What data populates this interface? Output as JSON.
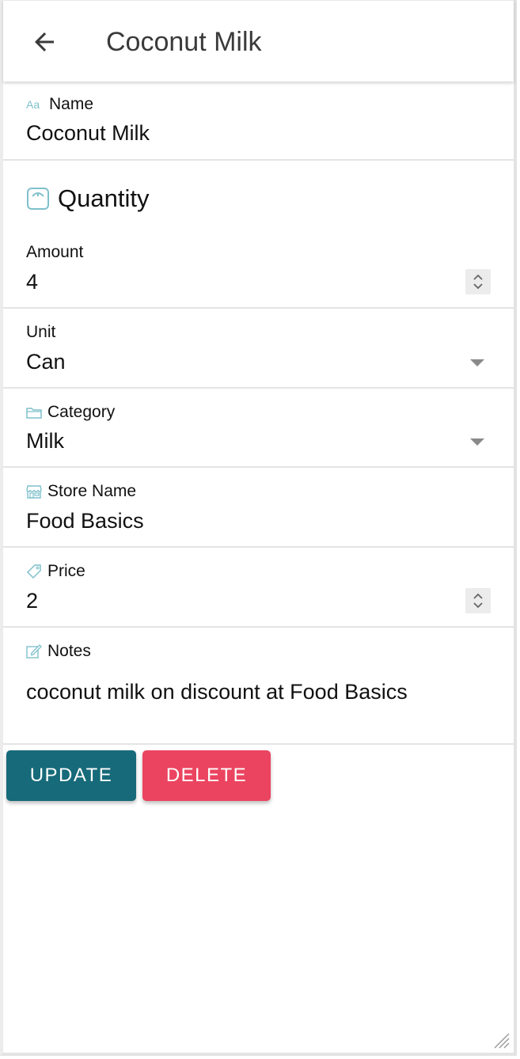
{
  "header": {
    "title": "Coconut Milk",
    "back_icon": "arrow-left-icon"
  },
  "fields": {
    "name": {
      "label": "Name",
      "value": "Coconut Milk",
      "icon": "text-format-icon"
    },
    "quantity": {
      "heading": "Quantity",
      "icon": "scale-icon"
    },
    "amount": {
      "label": "Amount",
      "value": "4"
    },
    "unit": {
      "label": "Unit",
      "value": "Can"
    },
    "category": {
      "label": "Category",
      "value": "Milk",
      "icon": "folder-icon"
    },
    "store": {
      "label": "Store Name",
      "value": "Food Basics",
      "icon": "store-icon"
    },
    "price": {
      "label": "Price",
      "value": "2",
      "icon": "tag-icon"
    },
    "notes": {
      "label": "Notes",
      "value": "coconut milk on discount at Food Basics",
      "icon": "edit-icon"
    }
  },
  "actions": {
    "update_label": "UPDATE",
    "delete_label": "DELETE"
  },
  "colors": {
    "update": "#176a79",
    "delete": "#eb4460",
    "icon_accent": "#7fc0cc"
  }
}
